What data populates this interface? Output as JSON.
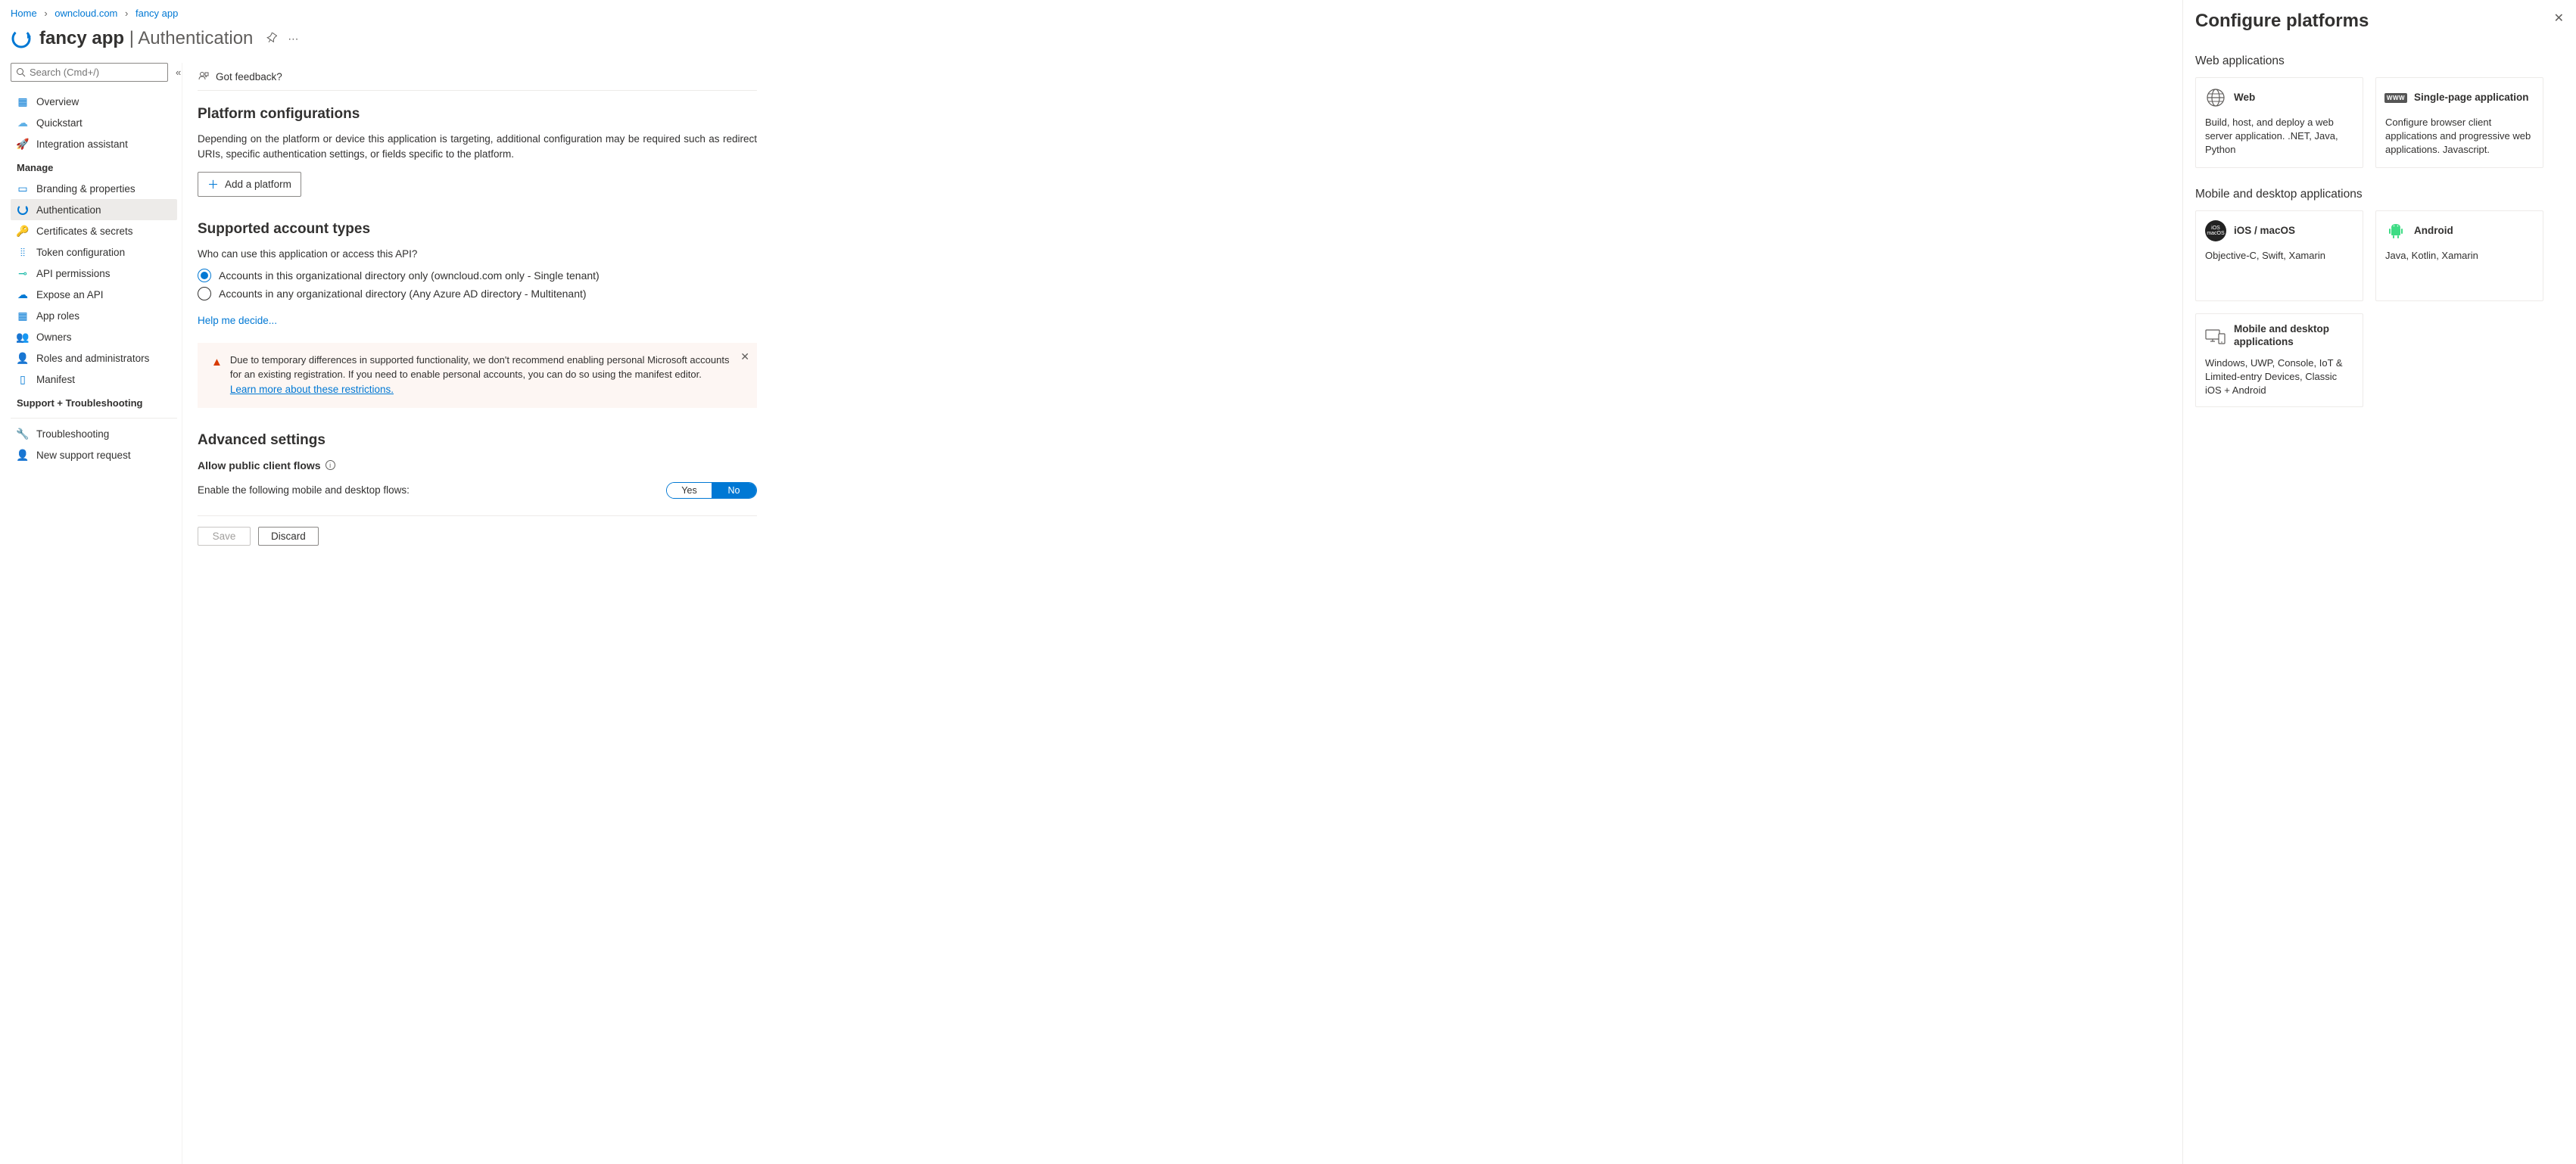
{
  "breadcrumb": {
    "home": "Home",
    "org": "owncloud.com",
    "app": "fancy app"
  },
  "header": {
    "app_name": "fancy app",
    "section": "Authentication"
  },
  "search": {
    "placeholder": "Search (Cmd+/)"
  },
  "nav": {
    "overview": "Overview",
    "quickstart": "Quickstart",
    "integration": "Integration assistant",
    "manage_label": "Manage",
    "branding": "Branding & properties",
    "authentication": "Authentication",
    "certificates": "Certificates & secrets",
    "token": "Token configuration",
    "api_permissions": "API permissions",
    "expose_api": "Expose an API",
    "app_roles": "App roles",
    "owners": "Owners",
    "roles_admins": "Roles and administrators",
    "manifest": "Manifest",
    "support_label": "Support + Troubleshooting",
    "troubleshooting": "Troubleshooting",
    "new_request": "New support request"
  },
  "feedback": "Got feedback?",
  "platform": {
    "title": "Platform configurations",
    "desc": "Depending on the platform or device this application is targeting, additional configuration may be required such as redirect URIs, specific authentication settings, or fields specific to the platform.",
    "add_button": "Add a platform"
  },
  "account_types": {
    "title": "Supported account types",
    "question": "Who can use this application or access this API?",
    "opt1": "Accounts in this organizational directory only (owncloud.com only - Single tenant)",
    "opt2": "Accounts in any organizational directory (Any Azure AD directory - Multitenant)",
    "help": "Help me decide..."
  },
  "warning": {
    "text": "Due to temporary differences in supported functionality, we don't recommend enabling personal Microsoft accounts for an existing registration. If you need to enable personal accounts, you can do so using the manifest editor. ",
    "link": "Learn more about these restrictions."
  },
  "advanced": {
    "title": "Advanced settings",
    "allow_label": "Allow public client flows",
    "enable_desc": "Enable the following mobile and desktop flows:",
    "yes": "Yes",
    "no": "No"
  },
  "footer": {
    "save": "Save",
    "discard": "Discard"
  },
  "panel": {
    "title": "Configure platforms",
    "web_label": "Web applications",
    "mobile_label": "Mobile and desktop applications",
    "cards": {
      "web": {
        "title": "Web",
        "desc": "Build, host, and deploy a web server application. .NET, Java, Python"
      },
      "spa": {
        "title": "Single-page application",
        "desc": "Configure browser client applications and progressive web applications. Javascript."
      },
      "ios": {
        "title": "iOS / macOS",
        "desc": "Objective-C, Swift, Xamarin"
      },
      "android": {
        "title": "Android",
        "desc": "Java, Kotlin, Xamarin"
      },
      "desktop": {
        "title": "Mobile and desktop applications",
        "desc": "Windows, UWP, Console, IoT & Limited-entry Devices, Classic iOS + Android"
      }
    }
  }
}
